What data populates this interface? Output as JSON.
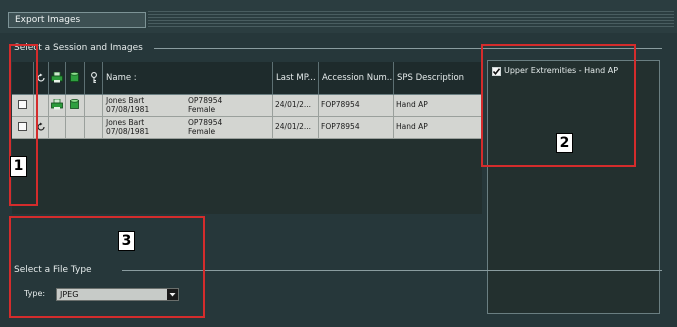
{
  "window": {
    "title": "Export Images"
  },
  "session_section": {
    "label": "Select a Session and Images"
  },
  "grid": {
    "columns": [
      "Name :",
      "Last MP...",
      "Accession  Num...",
      "SPS Description"
    ],
    "rows": [
      {
        "name_line1": "Jones Bart",
        "name_line2": "07/08/1981",
        "id_line1": "OP78954",
        "id_line2": "Female",
        "last_mp": "24/01/2...",
        "accession": "FOP78954",
        "sps": "Hand AP",
        "has_printer_icon": true,
        "has_refresh_icon": false
      },
      {
        "name_line1": "Jones Bart",
        "name_line2": "07/08/1981",
        "id_line1": "OP78954",
        "id_line2": "Female",
        "last_mp": "24/01/2...",
        "accession": "FOP78954",
        "sps": "Hand AP",
        "has_printer_icon": false,
        "has_refresh_icon": true
      }
    ]
  },
  "sps_panel": {
    "items": [
      {
        "label": "Upper Extremities - Hand AP",
        "checked": true
      }
    ]
  },
  "file_type_section": {
    "label": "Select a File Type",
    "type_label": "Type:",
    "type_value": "JPEG"
  },
  "annotations": [
    "1",
    "2",
    "3"
  ],
  "colors": {
    "background": "#26373a",
    "row_background": "#d3d5d1",
    "annotation_red": "#d42c2c"
  }
}
